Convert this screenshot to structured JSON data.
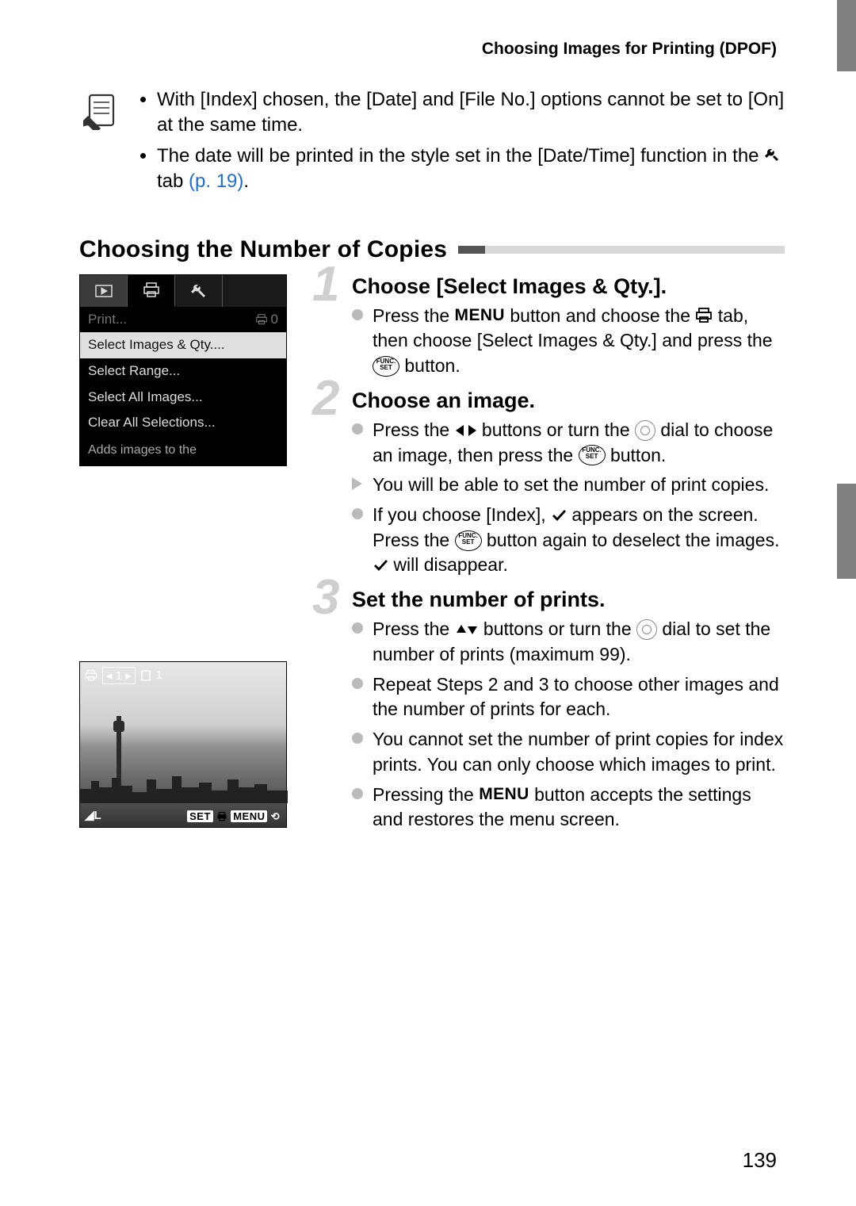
{
  "header": {
    "title": "Choosing Images for Printing (DPOF)"
  },
  "note": {
    "items": [
      {
        "text_a": "With [Index] chosen, the [Date] and [File No.] options cannot be set to [On] at the same time."
      },
      {
        "text_a": "The date will be printed in the style set in the [Date/Time] function in the ",
        "link": "(p. 19)",
        "tab_after": " tab ",
        "text_b": "."
      }
    ]
  },
  "section": {
    "title": "Choosing the Number of Copies"
  },
  "menu_screenshot": {
    "print_label": "Print...",
    "print_count": "0",
    "items": [
      "Select Images & Qty....",
      "Select Range...",
      "Select All Images...",
      "Clear All Selections..."
    ],
    "hint": "Adds images to the"
  },
  "image_screenshot": {
    "badge_num": "1",
    "right_num": "1",
    "bl": "L",
    "br_set": "SET",
    "br_menu": "MENU",
    "br_back_alt": "back"
  },
  "steps": [
    {
      "num": "1",
      "title": "Choose [Select Images & Qty.].",
      "body": [
        {
          "type": "dot",
          "frags": [
            {
              "t": "Press the "
            },
            {
              "icon": "menu-word",
              "t": "MENU"
            },
            {
              "t": " button and choose the "
            },
            {
              "icon": "print"
            },
            {
              "t": " tab, then choose [Select Images & Qty.] and press the "
            },
            {
              "icon": "funcset"
            },
            {
              "t": " button."
            }
          ]
        }
      ]
    },
    {
      "num": "2",
      "title": "Choose an image.",
      "body": [
        {
          "type": "dot",
          "frags": [
            {
              "t": "Press the "
            },
            {
              "icon": "leftright"
            },
            {
              "t": " buttons or turn the "
            },
            {
              "icon": "dial"
            },
            {
              "t": " dial to choose an image, then press the "
            },
            {
              "icon": "funcset"
            },
            {
              "t": " button."
            }
          ]
        },
        {
          "type": "tri",
          "frags": [
            {
              "t": "You will be able to set the number of print copies."
            }
          ]
        },
        {
          "type": "dot",
          "frags": [
            {
              "t": "If you choose [Index],  "
            },
            {
              "icon": "check"
            },
            {
              "t": "  appears on the screen. Press the "
            },
            {
              "icon": "funcset"
            },
            {
              "t": " button again to deselect the images.  "
            },
            {
              "icon": "check"
            },
            {
              "t": "  will disappear."
            }
          ]
        }
      ]
    },
    {
      "num": "3",
      "title": "Set the number of prints.",
      "body": [
        {
          "type": "dot",
          "frags": [
            {
              "t": "Press the "
            },
            {
              "icon": "updown"
            },
            {
              "t": " buttons or turn the "
            },
            {
              "icon": "dial"
            },
            {
              "t": " dial to set the number of prints (maximum 99)."
            }
          ]
        },
        {
          "type": "dot",
          "frags": [
            {
              "t": "Repeat Steps 2 and 3 to choose other images and the number of prints for each."
            }
          ]
        },
        {
          "type": "dot",
          "frags": [
            {
              "t": "You cannot set the number of print copies for index prints. You can only choose which images to print."
            }
          ]
        },
        {
          "type": "dot",
          "frags": [
            {
              "t": "Pressing the "
            },
            {
              "icon": "menu-word",
              "t": "MENU"
            },
            {
              "t": " button accepts the settings and restores the menu screen."
            }
          ]
        }
      ]
    }
  ],
  "page_number": "139",
  "icons": {
    "funcset_top": "FUNC.",
    "funcset_bot": "SET"
  }
}
